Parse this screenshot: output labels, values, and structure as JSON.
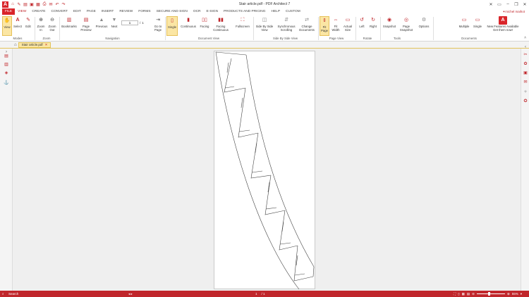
{
  "window": {
    "title": "Stair article.pdf  -  PDF Architect 7",
    "user": "michel maihot"
  },
  "menu": {
    "tabs": [
      "FILE",
      "VIEW",
      "CREATE",
      "CONVERT",
      "EDIT",
      "PAGE",
      "INSERT",
      "REVIEW",
      "FORMS",
      "SECURE AND SIGN",
      "OCR",
      "E-SIGN",
      "PRODUCTS AND PRICING",
      "HELP",
      "CUSTOM"
    ],
    "active": "VIEW"
  },
  "ribbon": {
    "modes": {
      "label": "Modes",
      "view": "View",
      "select": "Select",
      "edit": "Edit"
    },
    "zoom": {
      "label": "Zoom",
      "zoom_in": "Zoom In",
      "zoom_out": "Zoom Out"
    },
    "navigation": {
      "label": "Navigation",
      "bookmarks": "Bookmarks",
      "page_preview": "Page Preview",
      "previous": "Previous",
      "next": "Next",
      "current_page": "1",
      "total_pages": "1",
      "goto_page": "Go to Page"
    },
    "document_view": {
      "label": "Document View",
      "single": "Single",
      "continuous": "Continuous",
      "facing": "Facing",
      "facing_continuous": "Facing Continuous",
      "fullscreen": "Fullscreen"
    },
    "side_by_side": {
      "label": "Side By Side View",
      "side_by_side_view": "Side By Side View",
      "sync_scrolling": "Synchronous Scrolling",
      "change_docs": "Change Documents"
    },
    "page_view": {
      "label": "Page View",
      "fit_page": "Fit Page",
      "fit_width": "Fit Width",
      "actual_size": "Actual Size"
    },
    "rotate": {
      "label": "Rotate",
      "left": "Left",
      "right": "Right"
    },
    "tools": {
      "label": "Tools",
      "snapshot": "Snapshot",
      "page_snapshot": "Page Snapshot",
      "options": "Options"
    },
    "documents": {
      "label": "Documents",
      "multiple": "Multiple",
      "single": "Single",
      "new_features": "New Features Available Get them now!"
    }
  },
  "doc_tab": {
    "name": "Stair article.pdf"
  },
  "status": {
    "search": "Search",
    "page_current": "1",
    "page_total": "/ 1",
    "zoom": "55%"
  },
  "colors": {
    "brand": "#c0262b",
    "selected": "#fbe6a4"
  }
}
